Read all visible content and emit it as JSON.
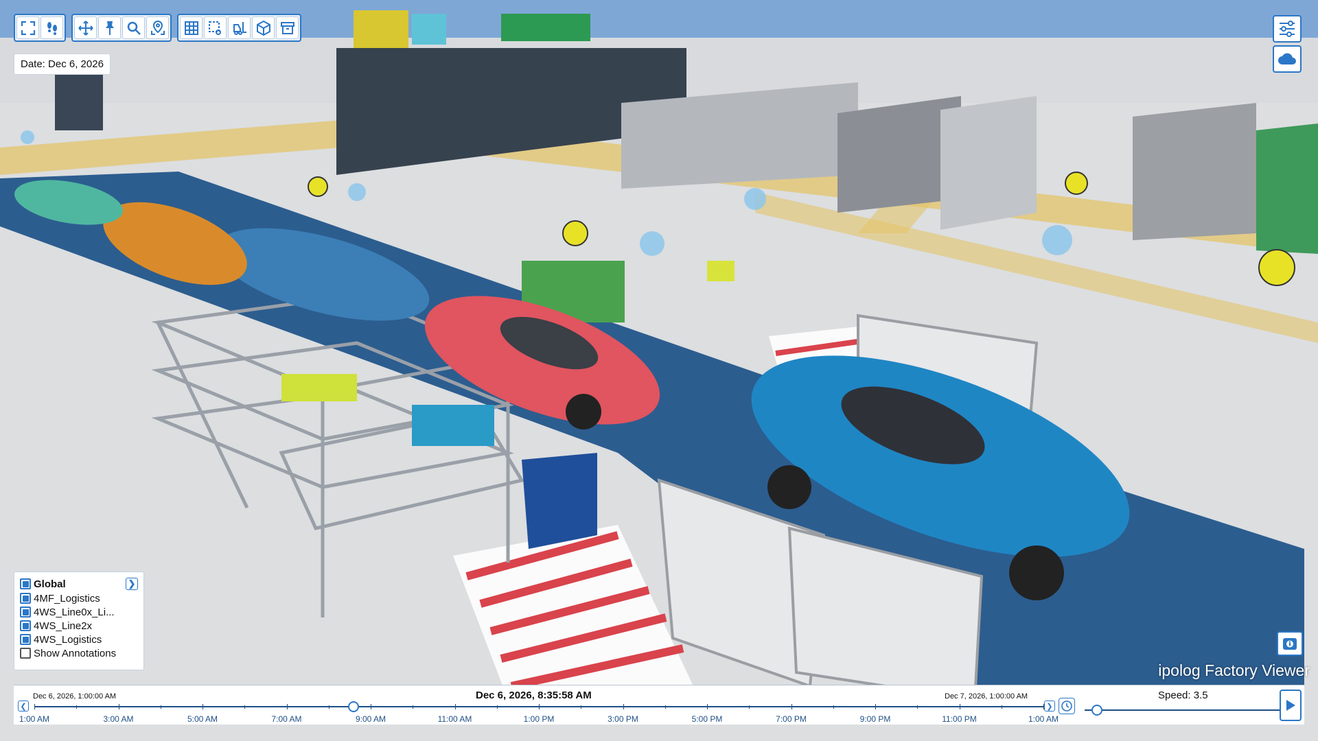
{
  "toolbar": {
    "group1": [
      {
        "icon": "fullscreen-icon"
      },
      {
        "icon": "footsteps-icon"
      }
    ],
    "group2": [
      {
        "icon": "move-icon"
      },
      {
        "icon": "pin-icon"
      },
      {
        "icon": "search-icon"
      },
      {
        "icon": "locate-icon"
      }
    ],
    "group3": [
      {
        "icon": "grid-icon"
      },
      {
        "icon": "area-select-icon"
      },
      {
        "icon": "forklift-icon"
      },
      {
        "icon": "cube-icon"
      },
      {
        "icon": "archive-box-icon"
      }
    ]
  },
  "right_tools": [
    {
      "icon": "settings-sliders-icon"
    },
    {
      "icon": "cloud-icon"
    }
  ],
  "date_label": "Date: Dec 6, 2026",
  "layers": {
    "global_label": "Global",
    "items": [
      {
        "label": "4MF_Logistics",
        "checked": true
      },
      {
        "label": "4WS_Line0x_Li...",
        "checked": true
      },
      {
        "label": "4WS_Line2x",
        "checked": true
      },
      {
        "label": "4WS_Logistics",
        "checked": true
      }
    ],
    "annotations_label": "Show Annotations",
    "annotations_checked": false
  },
  "brand": "ipolog Factory Viewer",
  "timeline": {
    "start_label": "Dec 6, 2026, 1:00:00 AM",
    "current_label": "Dec 6, 2026, 8:35:58 AM",
    "end_label": "Dec 7, 2026, 1:00:00 AM",
    "position_fraction": 0.316,
    "ticks": [
      "1:00 AM",
      "3:00 AM",
      "5:00 AM",
      "7:00 AM",
      "9:00 AM",
      "11:00 AM",
      "1:00 PM",
      "3:00 PM",
      "5:00 PM",
      "7:00 PM",
      "9:00 PM",
      "11:00 PM",
      "1:00 AM"
    ],
    "speed_label": "Speed:",
    "speed_value": "3.5"
  },
  "colors": {
    "accent": "#2b77c7",
    "track": "#1e4f86",
    "floor_aisle_blue": "#2c5d8f",
    "car_red": "#e0555f",
    "car_blue": "#1f86c4",
    "car_orange": "#d98b2b",
    "car_green": "#4fb7a0"
  }
}
